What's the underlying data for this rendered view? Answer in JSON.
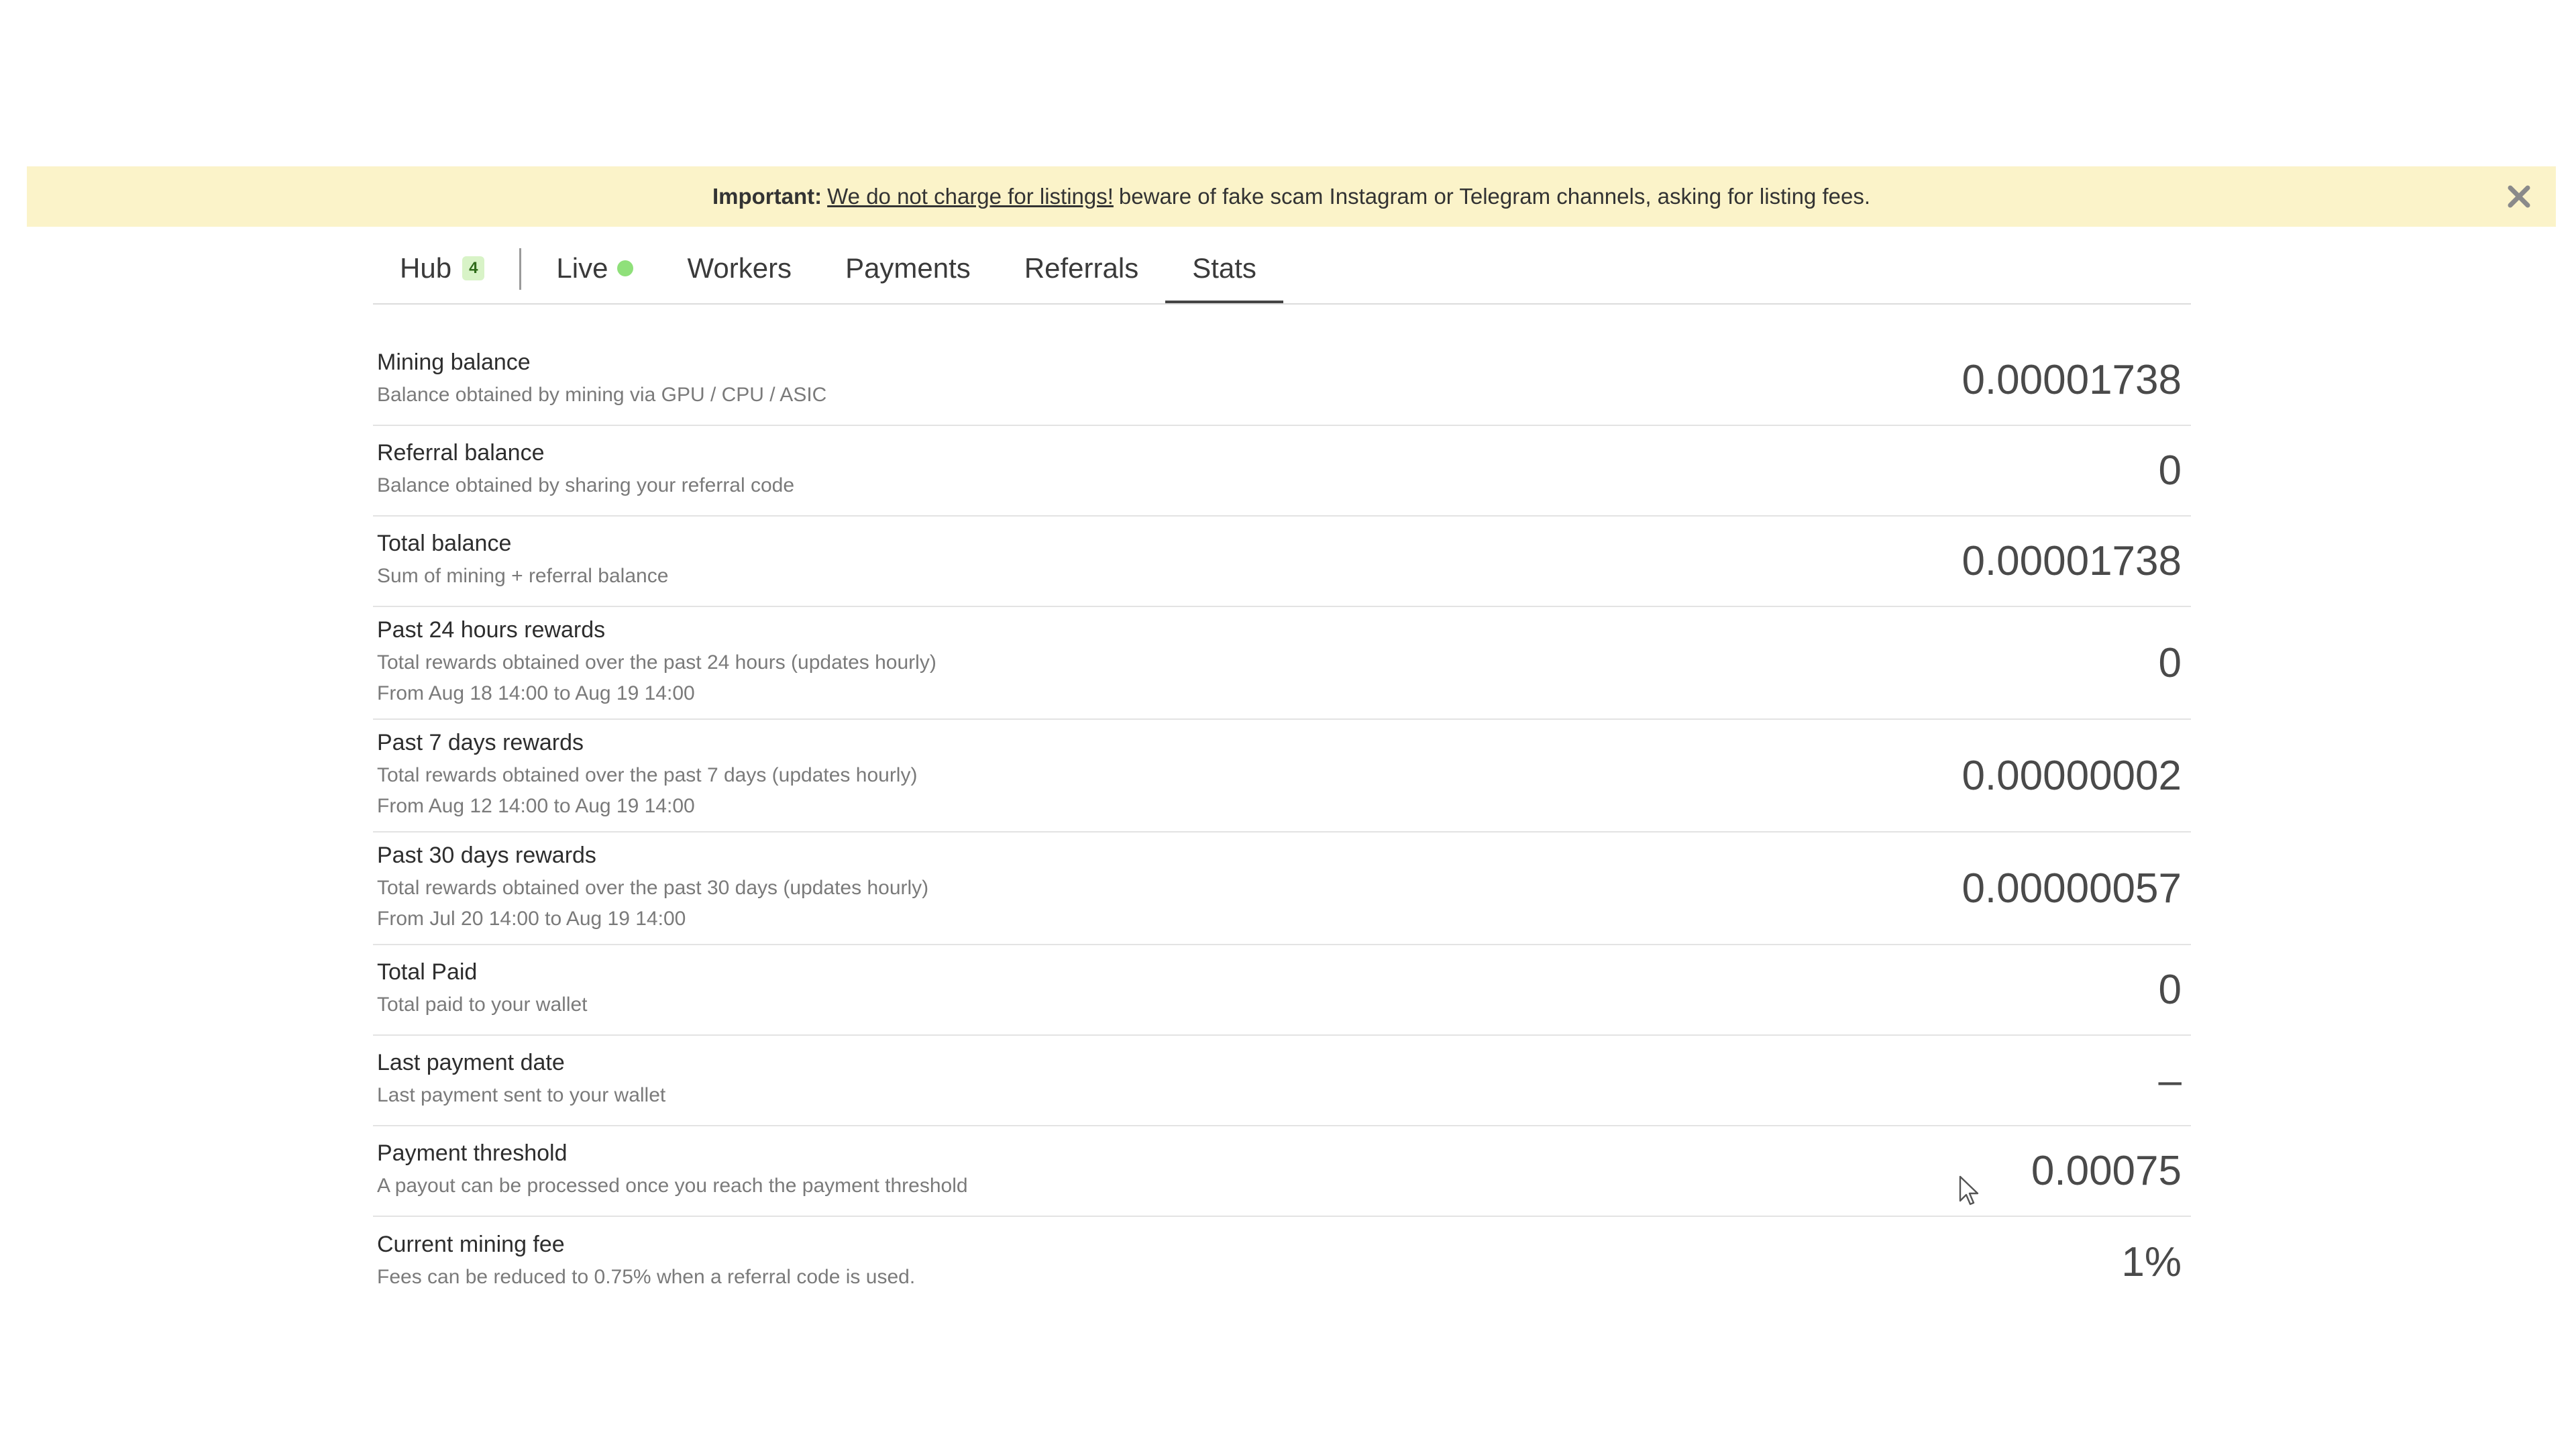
{
  "banner": {
    "important_label": "Important:",
    "link_text": "We do not charge for listings!",
    "message": "beware of fake scam Instagram or Telegram channels, asking for listing fees.",
    "close_icon": "close-icon"
  },
  "tabs": {
    "hub": {
      "label": "Hub",
      "badge": "4"
    },
    "live": {
      "label": "Live",
      "status_color": "#8fe07a"
    },
    "workers": {
      "label": "Workers"
    },
    "payments": {
      "label": "Payments"
    },
    "referrals": {
      "label": "Referrals"
    },
    "stats": {
      "label": "Stats",
      "active": true
    }
  },
  "stats": {
    "rows": [
      {
        "title": "Mining balance",
        "sub1": "Balance obtained by mining via GPU / CPU / ASIC",
        "value": "0.00001738"
      },
      {
        "title": "Referral balance",
        "sub1": "Balance obtained by sharing your referral code",
        "value": "0"
      },
      {
        "title": "Total balance",
        "sub1": "Sum of mining + referral balance",
        "value": "0.00001738"
      },
      {
        "title": "Past 24 hours rewards",
        "sub1": "Total rewards obtained over the past 24 hours (updates hourly)",
        "sub2": "From Aug 18 14:00 to Aug 19 14:00",
        "value": "0"
      },
      {
        "title": "Past 7 days rewards",
        "sub1": "Total rewards obtained over the past 7 days (updates hourly)",
        "sub2": "From Aug 12 14:00 to Aug 19 14:00",
        "value": "0.00000002"
      },
      {
        "title": "Past 30 days rewards",
        "sub1": "Total rewards obtained over the past 30 days (updates hourly)",
        "sub2": "From Jul 20 14:00 to Aug 19 14:00",
        "value": "0.00000057"
      },
      {
        "title": "Total Paid",
        "sub1": "Total paid to your wallet",
        "value": "0"
      },
      {
        "title": "Last payment date",
        "sub1": "Last payment sent to your wallet",
        "value": "–"
      },
      {
        "title": "Payment threshold",
        "sub1": "A payout can be processed once you reach the payment threshold",
        "value": "0.00075"
      },
      {
        "title": "Current mining fee",
        "sub1": "Fees can be reduced to 0.75% when a referral code is used.",
        "value": "1%"
      }
    ]
  },
  "colors": {
    "banner_bg": "#fbf3c9",
    "badge_bg": "#d8f3c7",
    "live_dot": "#8fe07a"
  }
}
